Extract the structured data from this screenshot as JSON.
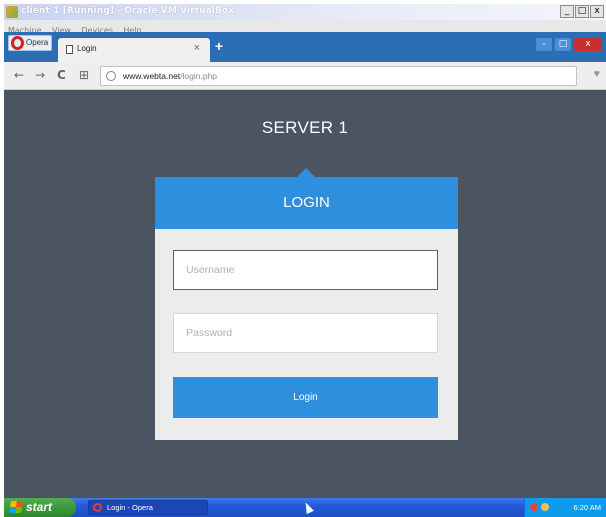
{
  "vbox": {
    "title": "client 1 [Running] - Oracle VM VirtualBox",
    "menu": [
      "Machine",
      "View",
      "Devices",
      "Help"
    ],
    "controls": [
      "_",
      "□",
      "x"
    ]
  },
  "browser": {
    "opera_label": "Opera",
    "tab_title": "Login",
    "tab_close": "×",
    "new_tab": "+",
    "window_controls": [
      "-",
      "□",
      "x"
    ],
    "nav": {
      "back": "←",
      "forward": "→",
      "reload": "C",
      "speed_dial": "⊞"
    },
    "url_host": "www.webta.net",
    "url_path": "/login.php",
    "heart": "♥"
  },
  "page": {
    "server_title": "SERVER 1",
    "login_heading": "LOGIN",
    "username_placeholder": "Username",
    "password_placeholder": "Password",
    "login_button": "Login",
    "colors": {
      "background": "#4a5561",
      "accent": "#2d8fde",
      "panel": "#ececec"
    }
  },
  "taskbar": {
    "start_label": "start",
    "task_item": "Login - Opera",
    "clock": "6:20 AM"
  }
}
